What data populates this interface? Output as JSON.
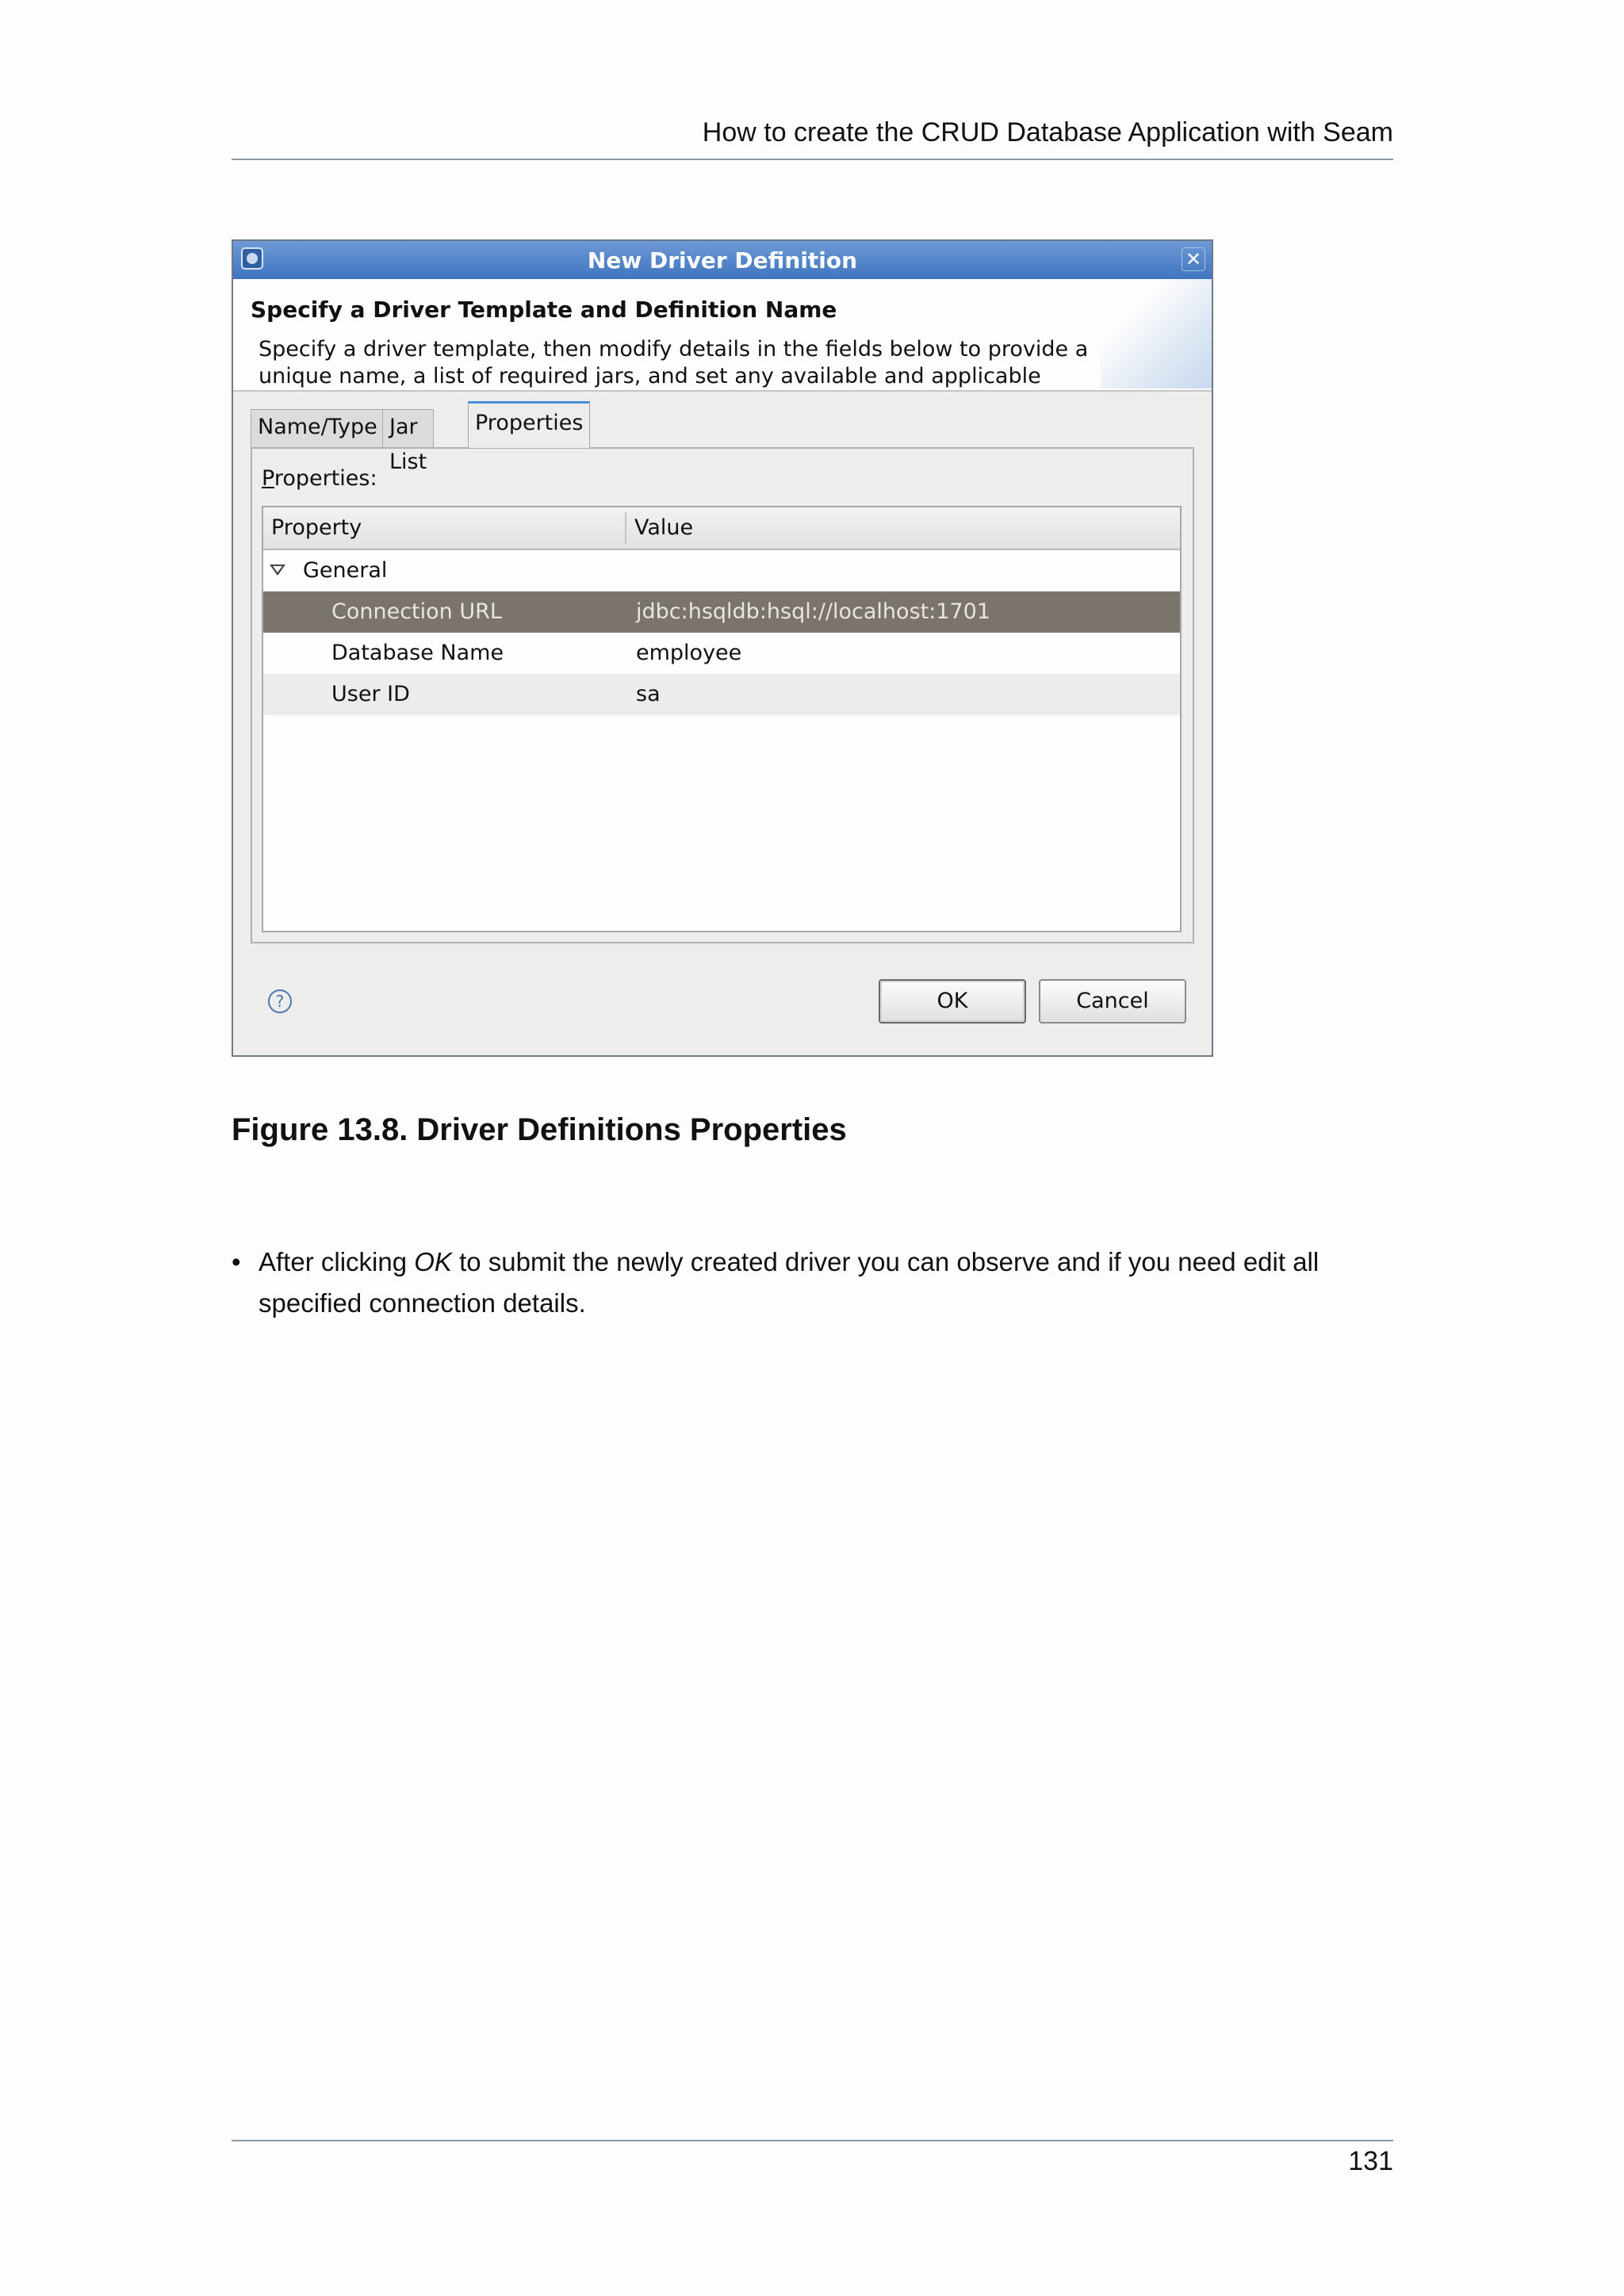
{
  "page_header": "How to create the CRUD Database Application with Seam",
  "dialog": {
    "title": "New Driver Definition",
    "close_symbol": "✕",
    "banner_title": "Specify a Driver Template and Definition Name",
    "banner_description": "Specify a driver template, then modify details in the fields below to provide a unique name, a list of required jars, and set any available and applicable",
    "tabs": [
      "Name/Type",
      "Jar List",
      "Properties"
    ],
    "active_tab": "Properties",
    "properties_label_first": "P",
    "properties_label_rest": "roperties:",
    "columns": [
      "Property",
      "Value"
    ],
    "group": "General",
    "rows": [
      {
        "property": "Connection URL",
        "value": "jdbc:hsqldb:hsql://localhost:1701"
      },
      {
        "property": "Database Name",
        "value": "employee"
      },
      {
        "property": "User ID",
        "value": "sa"
      }
    ],
    "help_symbol": "?",
    "ok_label": "OK",
    "cancel_label": "Cancel"
  },
  "caption": "Figure 13.8. Driver Definitions Properties",
  "bullet": {
    "symbol": "•",
    "before": "After clicking ",
    "emphasis": "OK",
    "after": " to submit the newly created driver you can observe and if you need edit all specified connection details."
  },
  "page_number": "131",
  "icons": {
    "app": "eclipse-app-icon",
    "close": "close-icon",
    "expand": "triangle-down-icon",
    "help": "help-icon"
  }
}
